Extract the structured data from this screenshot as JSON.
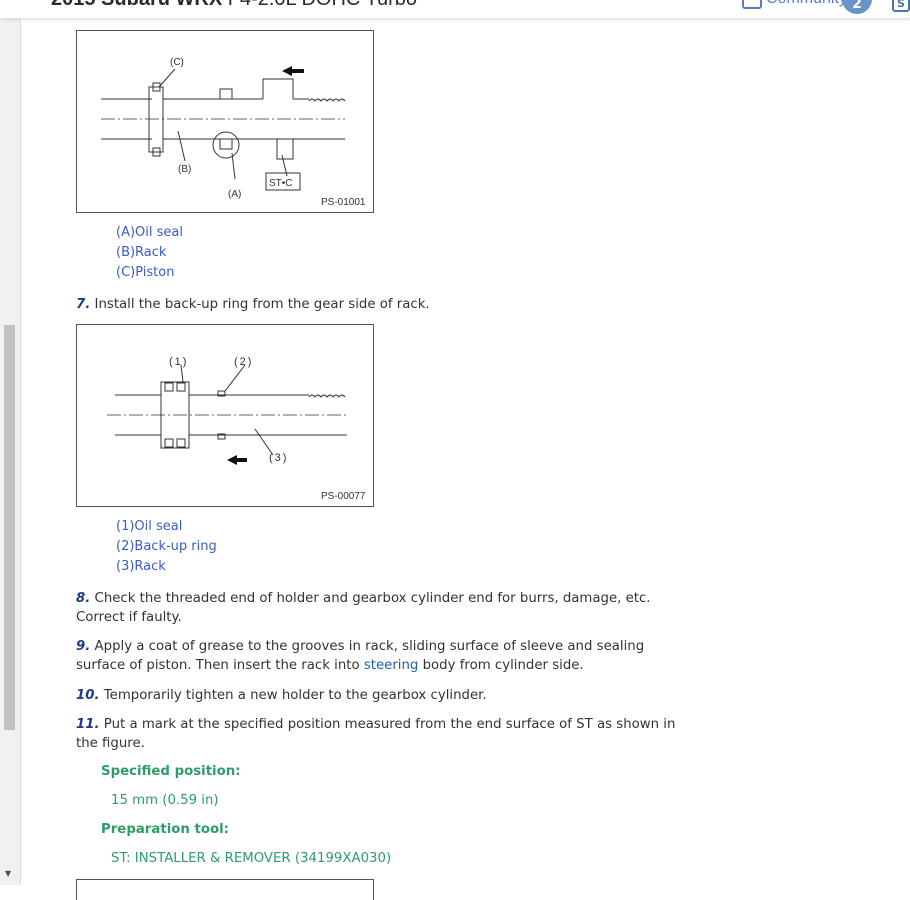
{
  "header": {
    "title_bold": "2015 Subaru WRX",
    "title_rest": " F4-2.0L DOHC Turbo",
    "community_label": "Community",
    "community_count": "2",
    "corner_button": "S"
  },
  "figure1": {
    "code": "PS-01001",
    "labels": {
      "a": "(A)",
      "b": "(B)",
      "c": "(C)",
      "st": "ST•C"
    },
    "legend": [
      "(A)Oil seal",
      "(B)Rack",
      "(C)Piston"
    ]
  },
  "step7": {
    "num": "7.",
    "text": " Install the back-up ring from the gear side of rack."
  },
  "figure2": {
    "code": "PS-00077",
    "labels": {
      "one": "(1)",
      "two": "(2)",
      "three": "(3)"
    },
    "legend": [
      "(1)Oil seal",
      "(2)Back-up ring",
      "(3)Rack"
    ]
  },
  "step8": {
    "num": "8.",
    "text": " Check the threaded end of holder and gearbox cylinder end for burrs, damage, etc. Correct if faulty."
  },
  "step9": {
    "num": "9.",
    "text_a": " Apply a coat of grease to the grooves in rack, sliding surface of sleeve and sealing surface of piston. Then insert the rack into ",
    "link": "steering",
    "text_b": " body from cylinder side."
  },
  "step10": {
    "num": "10.",
    "text": " Temporarily tighten a new holder to the gearbox cylinder."
  },
  "step11": {
    "num": "11.",
    "text": " Put a mark at the specified position measured from the end surface of ST as shown in the figure."
  },
  "spec": {
    "position_label": "Specified position:",
    "position_value": "15 mm (0.59 in)",
    "tool_label": "Preparation tool:",
    "tool_value": "ST: INSTALLER & REMOVER (34199XA030)"
  },
  "colors": {
    "accent_green": "#2e9c6a",
    "legend_blue": "#3b5cc6",
    "step_num_blue": "#1f3a8a",
    "link_blue": "#1a5fb4"
  }
}
